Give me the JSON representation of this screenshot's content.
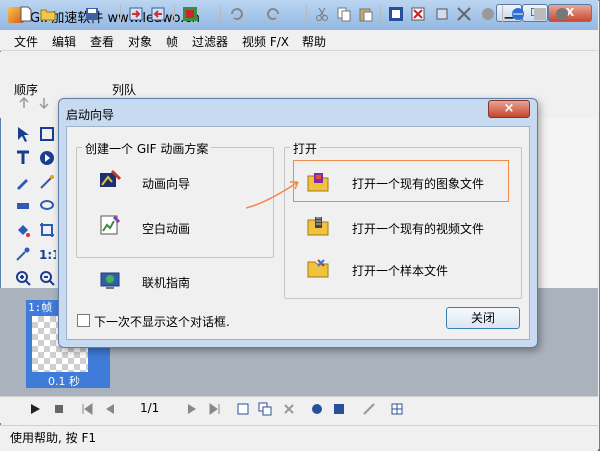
{
  "window": {
    "title": "GIF加速软件 www.leawo.cn",
    "min_label": "▁",
    "max_label": "☐",
    "close_label": "X"
  },
  "menu": [
    "文件",
    "编辑",
    "查看",
    "对象",
    "帧",
    "过滤器",
    "视频 F/X",
    "帮助"
  ],
  "subtoolbar": {
    "order_label": "顺序",
    "queue_label": "列队"
  },
  "frames": {
    "frame_label": "1:帧",
    "time_label": "0.1 秒"
  },
  "playbar": {
    "page": "1/1"
  },
  "status": {
    "text": "使用帮助, 按 F1"
  },
  "dialog": {
    "title": "启动向导",
    "close_glyph": "×",
    "create_group": {
      "label": "创建一个 GIF 动画方案",
      "options": [
        "动画向导",
        "空白动画",
        "联机指南"
      ]
    },
    "open_group": {
      "label": "打开",
      "options": [
        "打开一个现有的图象文件",
        "打开一个现有的视频文件",
        "打开一个样本文件"
      ]
    },
    "checkbox_label": "下一次不显示这个对话框.",
    "close_button": "关闭"
  },
  "colors": {
    "accent": "#3f7bd8",
    "highlight": "#f08a4a",
    "titlebar": "#a6c6ea"
  },
  "icons": {
    "toolbar": [
      "new-icon",
      "open-icon",
      "save-icon",
      "import-icon",
      "export-icon",
      "color-icon",
      "undo-icon",
      "redo-icon",
      "cut-icon",
      "copy-icon",
      "paste-icon",
      "frame-icon",
      "delete-icon",
      "resize-icon",
      "optimize-icon",
      "web-icon",
      "disable-icon",
      "more-icon"
    ]
  }
}
